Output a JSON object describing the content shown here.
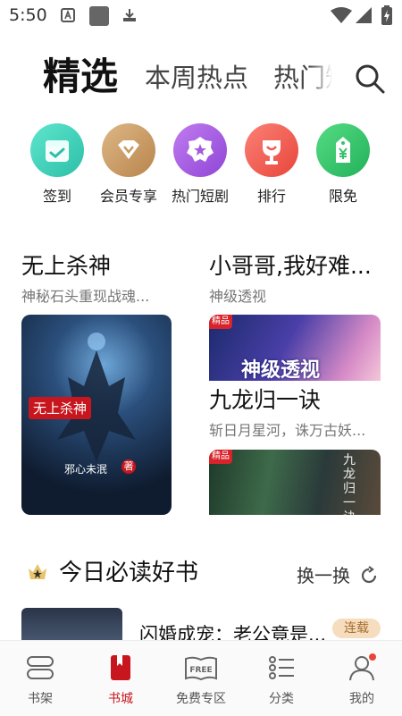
{
  "status_bar": {
    "time": "5:50"
  },
  "tabs": [
    {
      "label": "精选",
      "active": true
    },
    {
      "label": "本周热点"
    },
    {
      "label": "热门短"
    }
  ],
  "quick_entries": [
    {
      "label": "签到",
      "icon": "calendar-check-icon",
      "color": "#3fcfb8"
    },
    {
      "label": "会员专享",
      "icon": "vip-crown-icon",
      "color": "#c89a62"
    },
    {
      "label": "热门短剧",
      "icon": "star-badge-icon",
      "color": "#a45bdc"
    },
    {
      "label": "排行",
      "icon": "trophy-icon",
      "color": "#f0584c"
    },
    {
      "label": "限免",
      "icon": "yuan-tag-icon",
      "color": "#36c46a"
    }
  ],
  "books": {
    "left": {
      "title": "无上杀神",
      "subtitle": "神秘石头重现战魂...",
      "cover_title": "无上杀神",
      "cover_author": "邪心未泯",
      "cover_author_tag": "著"
    },
    "right_top": {
      "title": "小哥哥,我好难...",
      "subtitle": "神级透视",
      "badge": "精品",
      "cover_text": "神级透视"
    },
    "right_bottom": {
      "title": "九龙归一诀",
      "subtitle": "斩日月星河，诛万古妖...",
      "badge": "精品",
      "cover_text": "九龙归一诀"
    }
  },
  "section": {
    "title": "今日必读好书",
    "refresh_label": "换一换"
  },
  "list": [
    {
      "title": "闪婚成宠：老公竟是...",
      "tag": "连载"
    }
  ],
  "bottom_nav": [
    {
      "label": "书架",
      "icon": "bookshelf-icon"
    },
    {
      "label": "书城",
      "icon": "bookstore-icon",
      "active": true
    },
    {
      "label": "免费专区",
      "icon": "free-book-icon"
    },
    {
      "label": "分类",
      "icon": "category-list-icon"
    },
    {
      "label": "我的",
      "icon": "profile-icon",
      "has_dot": true
    }
  ],
  "colors": {
    "accent": "#c8161e",
    "tag_bg": "#f5ddbe",
    "tag_text": "#a66c2c"
  }
}
